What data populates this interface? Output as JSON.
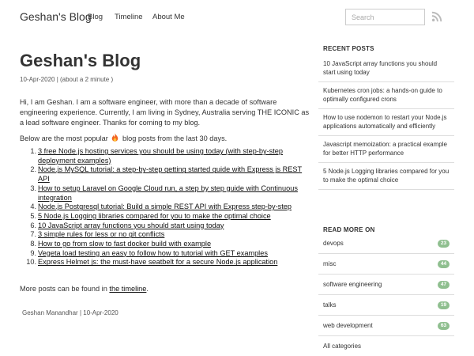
{
  "nav": {
    "brand": "Geshan's Blog",
    "links": [
      "Blog",
      "Timeline",
      "About Me"
    ],
    "search_placeholder": "Search",
    "rss_icon": "rss-icon"
  },
  "main": {
    "title": "Geshan's Blog",
    "meta": "10-Apr-2020 | (about a 2 minute )",
    "intro": "Hi, I am Geshan. I am a software engineer, with more than a decade of software engineering experience. Currently, I am living in Sydney, Australia serving THE ICONIC as a lead software engineer. Thanks for coming to my blog.",
    "popular_before": "Below are the most popular",
    "popular_after": "blog posts from the last 30 days.",
    "popular_icon": "fire-emoji-icon",
    "posts": [
      {
        "num": "1.",
        "title": "3 free Node.js hosting services you should be using today (with step-by-step deployment examples)"
      },
      {
        "num": "2.",
        "title": "Node.js MySQL tutorial: a step-by-step getting started guide with Express js REST API"
      },
      {
        "num": "3.",
        "title": "How to setup Laravel on Google Cloud run, a step by step guide with Continuous integration"
      },
      {
        "num": "4.",
        "title": "Node.js Postgresql tutorial: Build a simple REST API with Express step-by-step"
      },
      {
        "num": "5.",
        "title": "5 Node.js Logging libraries compared for you to make the optimal choice"
      },
      {
        "num": "6.",
        "title": "10 JavaScript array functions you should start using today"
      },
      {
        "num": "7.",
        "title": "3 simple rules for less or no git conflicts"
      },
      {
        "num": "8.",
        "title": "How to go from slow to fast docker build with example"
      },
      {
        "num": "9.",
        "title": "Vegeta load testing an easy to follow how to tutorial with GET examples"
      },
      {
        "num": "10.",
        "title": "Express Helmet js: the must-have seatbelt for a secure Node.js application"
      }
    ],
    "more_before": "More posts can be found in",
    "more_link": "the timeline",
    "more_after": ".",
    "footer_meta": "Geshan Manandhar |  10-Apr-2020"
  },
  "sidebar": {
    "recent_heading": "RECENT POSTS",
    "recent": [
      "10 JavaScript array functions you should start using today",
      "Kubernetes cron jobs: a hands-on guide to optimally configured crons",
      "How to use nodemon to restart your Node.js applications automatically and efficiently",
      "Javascript memoization: a practical example for better HTTP performance",
      "5 Node.js Logging libraries compared for you to make the optimal choice"
    ],
    "more_heading": "READ MORE ON",
    "categories": [
      {
        "name": "devops",
        "count": "23"
      },
      {
        "name": "misc",
        "count": "44"
      },
      {
        "name": "software engineering",
        "count": "47"
      },
      {
        "name": "talks",
        "count": "19"
      },
      {
        "name": "web development",
        "count": "63"
      }
    ],
    "all_categories": "All categories"
  },
  "colors": {
    "badge": "#8fbf8f",
    "text": "#333333",
    "divider": "#dddddd"
  }
}
